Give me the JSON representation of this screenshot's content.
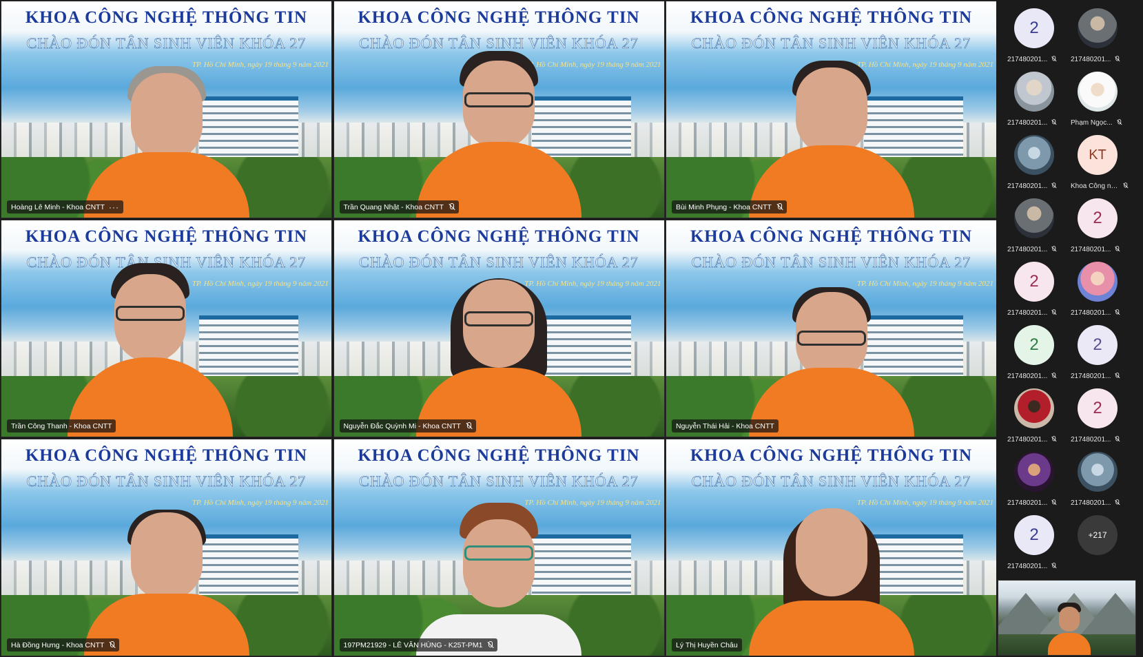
{
  "banner": {
    "title": "KHOA CÔNG NGHỆ THÔNG TIN",
    "subtitle": "CHÀO ĐÓN TÂN SINH VIÊN KHÓA 27",
    "date": "TP. Hồ Chí Minh, ngày 19 tháng 9 năm 2021"
  },
  "tiles": [
    {
      "name": "Hoàng Lê Minh - Khoa CNTT",
      "indicator": "···"
    },
    {
      "name": "Trần Quang Nhật - Khoa CNTT",
      "indicator": "mic-off"
    },
    {
      "name": "Bùi Minh Phụng - Khoa CNTT",
      "indicator": "mic-off"
    },
    {
      "name": "Trần Công Thanh - Khoa CNTT",
      "indicator": ""
    },
    {
      "name": "Nguyễn Đắc Quỳnh Mi - Khoa CNTT",
      "indicator": "mic-off"
    },
    {
      "name": "Nguyễn Thái Hải - Khoa CNTT",
      "indicator": ""
    },
    {
      "name": "Hà Đồng Hưng - Khoa CNTT",
      "indicator": "mic-off"
    },
    {
      "name": "197PM21929 - LÊ VĂN HÙNG - K25T-PM1",
      "indicator": "mic-off"
    },
    {
      "name": "Lý Thị Huyền Châu",
      "indicator": ""
    }
  ],
  "participants": [
    {
      "avatar": "2",
      "label": "217480201..."
    },
    {
      "avatar": "",
      "label": "217480201..."
    },
    {
      "avatar": "",
      "label": "217480201..."
    },
    {
      "avatar": "",
      "label": "Phạm Ngọc..."
    },
    {
      "avatar": "",
      "label": "217480201..."
    },
    {
      "avatar": "KT",
      "label": "Khoa Công ngh..."
    },
    {
      "avatar": "",
      "label": "217480201..."
    },
    {
      "avatar": "2",
      "label": "217480201..."
    },
    {
      "avatar": "2",
      "label": "217480201..."
    },
    {
      "avatar": "",
      "label": "217480201..."
    },
    {
      "avatar": "2",
      "label": "217480201..."
    },
    {
      "avatar": "2",
      "label": "217480201..."
    },
    {
      "avatar": "",
      "label": "217480201..."
    },
    {
      "avatar": "2",
      "label": "217480201..."
    },
    {
      "avatar": "",
      "label": "217480201..."
    },
    {
      "avatar": "",
      "label": "217480201..."
    },
    {
      "avatar": "2",
      "label": "217480201..."
    },
    {
      "avatar": "+217",
      "label": ""
    }
  ],
  "colors": {
    "background": "#1b1b1b",
    "banner_title": "#1b3a9a",
    "shirt_orange": "#f07b22"
  }
}
